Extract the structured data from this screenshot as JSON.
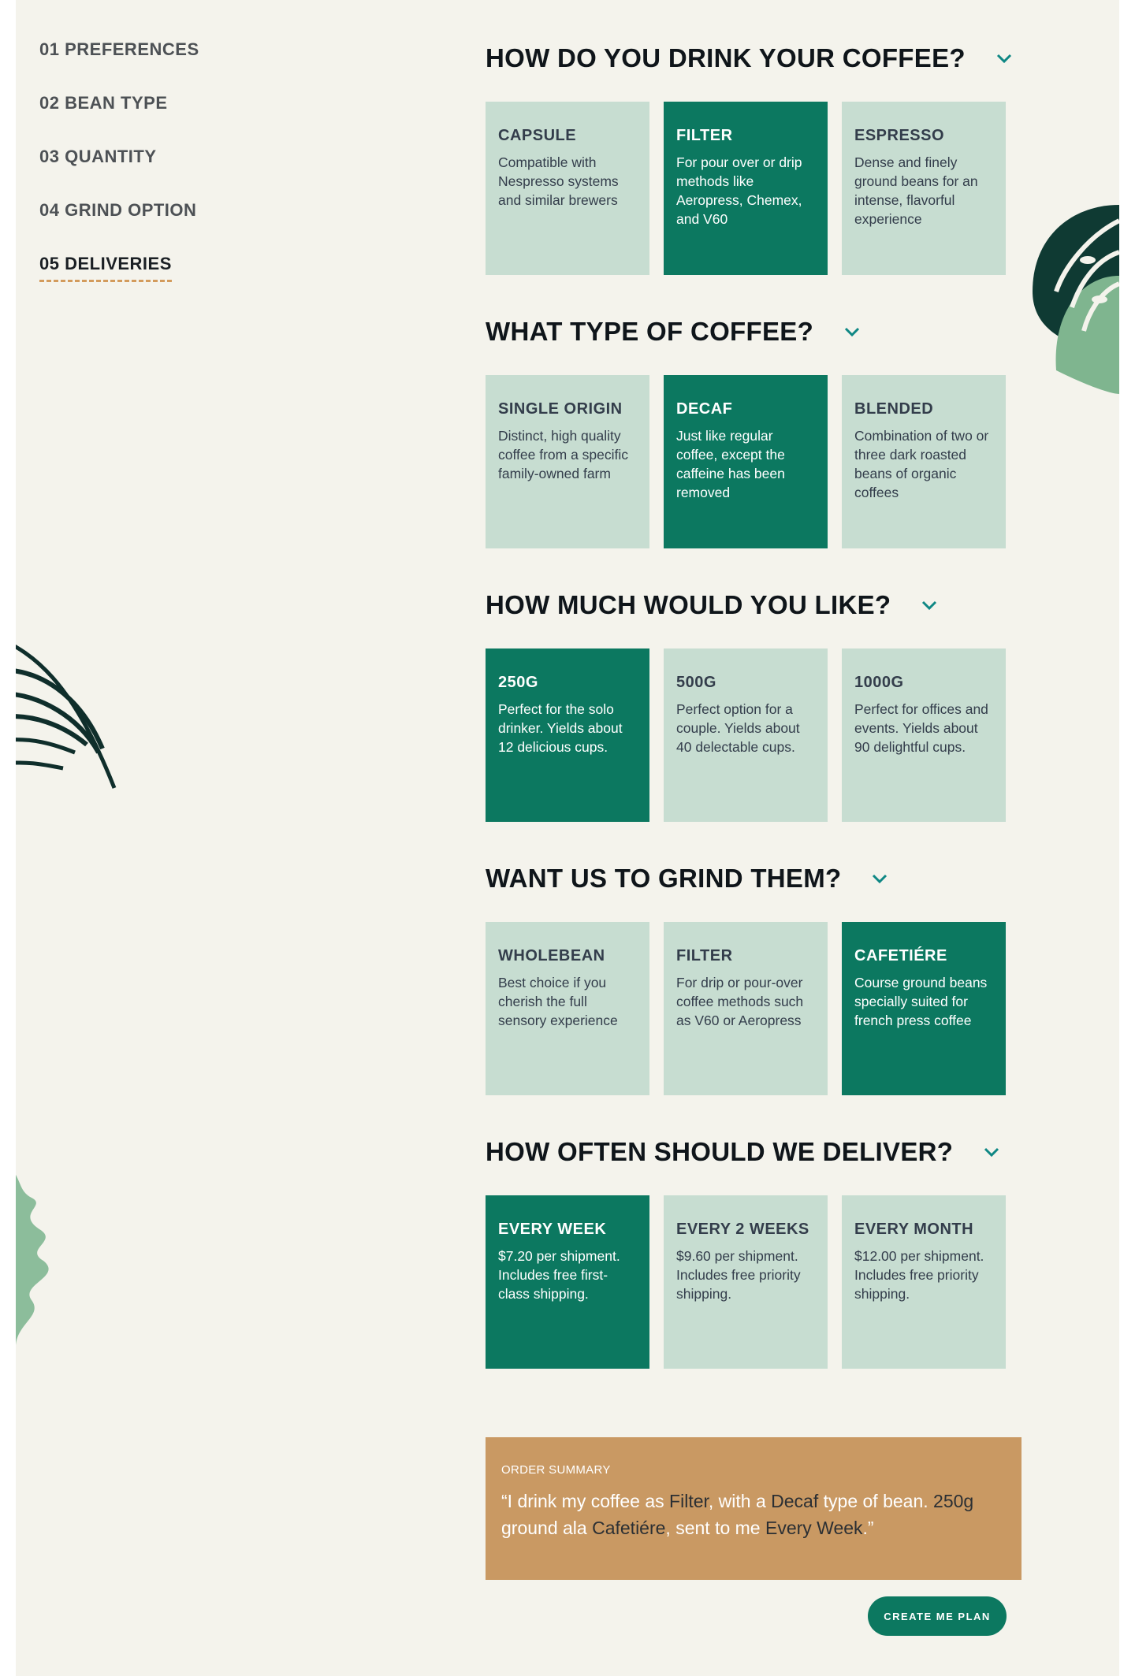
{
  "sidebar": {
    "items": [
      {
        "label": "01 PREFERENCES"
      },
      {
        "label": "02 BEAN TYPE"
      },
      {
        "label": "03 QUANTITY"
      },
      {
        "label": "04 GRIND OPTION"
      },
      {
        "label": "05 DELIVERIES",
        "active": true
      }
    ]
  },
  "questions": [
    {
      "title": "HOW DO YOU DRINK YOUR COFFEE?",
      "options": [
        {
          "title": "CAPSULE",
          "desc": "Compatible with Nespresso systems and similar brewers",
          "selected": false
        },
        {
          "title": "FILTER",
          "desc": "For pour over or drip methods like Aeropress, Chemex, and V60",
          "selected": true
        },
        {
          "title": "ESPRESSO",
          "desc": "Dense and finely ground beans for an intense, flavorful experience",
          "selected": false
        }
      ]
    },
    {
      "title": "WHAT TYPE OF COFFEE?",
      "options": [
        {
          "title": "SINGLE ORIGIN",
          "desc": "Distinct, high quality coffee from a specific family-owned farm",
          "selected": false
        },
        {
          "title": "DECAF",
          "desc": "Just like regular coffee, except the caffeine has been removed",
          "selected": true
        },
        {
          "title": "BLENDED",
          "desc": "Combination of two or three dark roasted beans of organic coffees",
          "selected": false
        }
      ]
    },
    {
      "title": "HOW MUCH WOULD YOU LIKE?",
      "options": [
        {
          "title": "250G",
          "desc": "Perfect for the solo drinker. Yields about 12 delicious cups.",
          "selected": true
        },
        {
          "title": "500G",
          "desc": "Perfect option for a couple. Yields about 40 delectable cups.",
          "selected": false
        },
        {
          "title": "1000G",
          "desc": "Perfect for offices and events. Yields about 90 delightful cups.",
          "selected": false
        }
      ]
    },
    {
      "title": "WANT US TO GRIND THEM?",
      "options": [
        {
          "title": "WHOLEBEAN",
          "desc": "Best choice if you cherish the full sensory experience",
          "selected": false
        },
        {
          "title": "FILTER",
          "desc": "For drip or pour-over coffee methods such as V60 or Aeropress",
          "selected": false
        },
        {
          "title": "CAFETIÉRE",
          "desc": "Course ground beans specially suited for french press coffee",
          "selected": true
        }
      ]
    },
    {
      "title": "HOW OFTEN SHOULD WE DELIVER?",
      "options": [
        {
          "title": "EVERY WEEK",
          "desc": "$7.20 per shipment. Includes free first-class shipping.",
          "selected": true
        },
        {
          "title": "EVERY 2 WEEKS",
          "desc": "$9.60 per shipment. Includes free priority shipping.",
          "selected": false
        },
        {
          "title": "EVERY MONTH",
          "desc": "$12.00 per shipment. Includes free priority shipping.",
          "selected": false
        }
      ]
    }
  ],
  "summary": {
    "label": "ORDER SUMMARY",
    "open_quote": "“I drink my coffee as ",
    "how": "Filter",
    "mid1": ", with a ",
    "type": "Decaf",
    "mid2": " type of bean. ",
    "quantity": "250g",
    "mid3": " ground ala ",
    "grind": "Cafetiére",
    "mid4": ", sent to me ",
    "frequency": "Every Week",
    "close_quote": ".”"
  },
  "cta": {
    "label": "CREATE ME PLAN"
  },
  "colors": {
    "background": "#f4f3ec",
    "card": "#c7ddd1",
    "card_selected": "#0c7860",
    "summary": "#c99963",
    "accent_underline": "#d39b5c"
  },
  "icons": {
    "chevron": "chevron-down-icon",
    "decor": "plant-leaf-icon"
  }
}
